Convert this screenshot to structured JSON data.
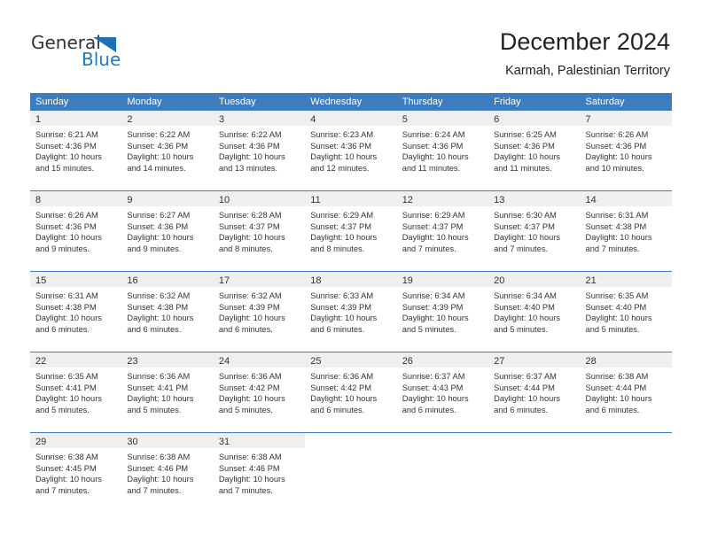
{
  "brand": {
    "line1": "General",
    "line2": "Blue",
    "triangle_color": "#1f6fb5"
  },
  "header": {
    "title": "December 2024",
    "subtitle": "Karmah, Palestinian Territory"
  },
  "theme": {
    "header_blue": "#3d7dbf",
    "day_band_gray": "#efefef",
    "text": "#333333"
  },
  "weekdays": [
    "Sunday",
    "Monday",
    "Tuesday",
    "Wednesday",
    "Thursday",
    "Friday",
    "Saturday"
  ],
  "weeks": [
    [
      {
        "day": "1",
        "sunrise": "Sunrise: 6:21 AM",
        "sunset": "Sunset: 4:36 PM",
        "daylight_1": "Daylight: 10 hours",
        "daylight_2": "and 15 minutes."
      },
      {
        "day": "2",
        "sunrise": "Sunrise: 6:22 AM",
        "sunset": "Sunset: 4:36 PM",
        "daylight_1": "Daylight: 10 hours",
        "daylight_2": "and 14 minutes."
      },
      {
        "day": "3",
        "sunrise": "Sunrise: 6:22 AM",
        "sunset": "Sunset: 4:36 PM",
        "daylight_1": "Daylight: 10 hours",
        "daylight_2": "and 13 minutes."
      },
      {
        "day": "4",
        "sunrise": "Sunrise: 6:23 AM",
        "sunset": "Sunset: 4:36 PM",
        "daylight_1": "Daylight: 10 hours",
        "daylight_2": "and 12 minutes."
      },
      {
        "day": "5",
        "sunrise": "Sunrise: 6:24 AM",
        "sunset": "Sunset: 4:36 PM",
        "daylight_1": "Daylight: 10 hours",
        "daylight_2": "and 11 minutes."
      },
      {
        "day": "6",
        "sunrise": "Sunrise: 6:25 AM",
        "sunset": "Sunset: 4:36 PM",
        "daylight_1": "Daylight: 10 hours",
        "daylight_2": "and 11 minutes."
      },
      {
        "day": "7",
        "sunrise": "Sunrise: 6:26 AM",
        "sunset": "Sunset: 4:36 PM",
        "daylight_1": "Daylight: 10 hours",
        "daylight_2": "and 10 minutes."
      }
    ],
    [
      {
        "day": "8",
        "sunrise": "Sunrise: 6:26 AM",
        "sunset": "Sunset: 4:36 PM",
        "daylight_1": "Daylight: 10 hours",
        "daylight_2": "and 9 minutes."
      },
      {
        "day": "9",
        "sunrise": "Sunrise: 6:27 AM",
        "sunset": "Sunset: 4:36 PM",
        "daylight_1": "Daylight: 10 hours",
        "daylight_2": "and 9 minutes."
      },
      {
        "day": "10",
        "sunrise": "Sunrise: 6:28 AM",
        "sunset": "Sunset: 4:37 PM",
        "daylight_1": "Daylight: 10 hours",
        "daylight_2": "and 8 minutes."
      },
      {
        "day": "11",
        "sunrise": "Sunrise: 6:29 AM",
        "sunset": "Sunset: 4:37 PM",
        "daylight_1": "Daylight: 10 hours",
        "daylight_2": "and 8 minutes."
      },
      {
        "day": "12",
        "sunrise": "Sunrise: 6:29 AM",
        "sunset": "Sunset: 4:37 PM",
        "daylight_1": "Daylight: 10 hours",
        "daylight_2": "and 7 minutes."
      },
      {
        "day": "13",
        "sunrise": "Sunrise: 6:30 AM",
        "sunset": "Sunset: 4:37 PM",
        "daylight_1": "Daylight: 10 hours",
        "daylight_2": "and 7 minutes."
      },
      {
        "day": "14",
        "sunrise": "Sunrise: 6:31 AM",
        "sunset": "Sunset: 4:38 PM",
        "daylight_1": "Daylight: 10 hours",
        "daylight_2": "and 7 minutes."
      }
    ],
    [
      {
        "day": "15",
        "sunrise": "Sunrise: 6:31 AM",
        "sunset": "Sunset: 4:38 PM",
        "daylight_1": "Daylight: 10 hours",
        "daylight_2": "and 6 minutes."
      },
      {
        "day": "16",
        "sunrise": "Sunrise: 6:32 AM",
        "sunset": "Sunset: 4:38 PM",
        "daylight_1": "Daylight: 10 hours",
        "daylight_2": "and 6 minutes."
      },
      {
        "day": "17",
        "sunrise": "Sunrise: 6:32 AM",
        "sunset": "Sunset: 4:39 PM",
        "daylight_1": "Daylight: 10 hours",
        "daylight_2": "and 6 minutes."
      },
      {
        "day": "18",
        "sunrise": "Sunrise: 6:33 AM",
        "sunset": "Sunset: 4:39 PM",
        "daylight_1": "Daylight: 10 hours",
        "daylight_2": "and 6 minutes."
      },
      {
        "day": "19",
        "sunrise": "Sunrise: 6:34 AM",
        "sunset": "Sunset: 4:39 PM",
        "daylight_1": "Daylight: 10 hours",
        "daylight_2": "and 5 minutes."
      },
      {
        "day": "20",
        "sunrise": "Sunrise: 6:34 AM",
        "sunset": "Sunset: 4:40 PM",
        "daylight_1": "Daylight: 10 hours",
        "daylight_2": "and 5 minutes."
      },
      {
        "day": "21",
        "sunrise": "Sunrise: 6:35 AM",
        "sunset": "Sunset: 4:40 PM",
        "daylight_1": "Daylight: 10 hours",
        "daylight_2": "and 5 minutes."
      }
    ],
    [
      {
        "day": "22",
        "sunrise": "Sunrise: 6:35 AM",
        "sunset": "Sunset: 4:41 PM",
        "daylight_1": "Daylight: 10 hours",
        "daylight_2": "and 5 minutes."
      },
      {
        "day": "23",
        "sunrise": "Sunrise: 6:36 AM",
        "sunset": "Sunset: 4:41 PM",
        "daylight_1": "Daylight: 10 hours",
        "daylight_2": "and 5 minutes."
      },
      {
        "day": "24",
        "sunrise": "Sunrise: 6:36 AM",
        "sunset": "Sunset: 4:42 PM",
        "daylight_1": "Daylight: 10 hours",
        "daylight_2": "and 5 minutes."
      },
      {
        "day": "25",
        "sunrise": "Sunrise: 6:36 AM",
        "sunset": "Sunset: 4:42 PM",
        "daylight_1": "Daylight: 10 hours",
        "daylight_2": "and 6 minutes."
      },
      {
        "day": "26",
        "sunrise": "Sunrise: 6:37 AM",
        "sunset": "Sunset: 4:43 PM",
        "daylight_1": "Daylight: 10 hours",
        "daylight_2": "and 6 minutes."
      },
      {
        "day": "27",
        "sunrise": "Sunrise: 6:37 AM",
        "sunset": "Sunset: 4:44 PM",
        "daylight_1": "Daylight: 10 hours",
        "daylight_2": "and 6 minutes."
      },
      {
        "day": "28",
        "sunrise": "Sunrise: 6:38 AM",
        "sunset": "Sunset: 4:44 PM",
        "daylight_1": "Daylight: 10 hours",
        "daylight_2": "and 6 minutes."
      }
    ],
    [
      {
        "day": "29",
        "sunrise": "Sunrise: 6:38 AM",
        "sunset": "Sunset: 4:45 PM",
        "daylight_1": "Daylight: 10 hours",
        "daylight_2": "and 7 minutes."
      },
      {
        "day": "30",
        "sunrise": "Sunrise: 6:38 AM",
        "sunset": "Sunset: 4:46 PM",
        "daylight_1": "Daylight: 10 hours",
        "daylight_2": "and 7 minutes."
      },
      {
        "day": "31",
        "sunrise": "Sunrise: 6:38 AM",
        "sunset": "Sunset: 4:46 PM",
        "daylight_1": "Daylight: 10 hours",
        "daylight_2": "and 7 minutes."
      },
      {
        "day": "",
        "sunrise": "",
        "sunset": "",
        "daylight_1": "",
        "daylight_2": ""
      },
      {
        "day": "",
        "sunrise": "",
        "sunset": "",
        "daylight_1": "",
        "daylight_2": ""
      },
      {
        "day": "",
        "sunrise": "",
        "sunset": "",
        "daylight_1": "",
        "daylight_2": ""
      },
      {
        "day": "",
        "sunrise": "",
        "sunset": "",
        "daylight_1": "",
        "daylight_2": ""
      }
    ]
  ]
}
